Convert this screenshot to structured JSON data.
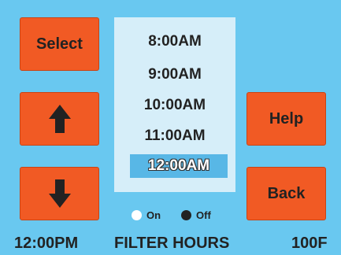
{
  "buttons": {
    "select_label": "Select",
    "up_icon": "arrow-up-icon",
    "down_icon": "arrow-down-icon",
    "help_label": "Help",
    "back_label": "Back"
  },
  "time_list": {
    "items": [
      "8:00AM",
      "9:00AM",
      "10:00AM",
      "11:00AM",
      "12:00AM"
    ],
    "selected": "12:00AM"
  },
  "legend": {
    "on_label": "On",
    "off_label": "Off"
  },
  "status_bar": {
    "time": "12:00PM",
    "mode": "FILTER HOURS",
    "temperature": "100F"
  },
  "colors": {
    "background": "#69c8f0",
    "button": "#f15a24",
    "panel": "#d6eef9",
    "selection": "#58b7e6"
  }
}
